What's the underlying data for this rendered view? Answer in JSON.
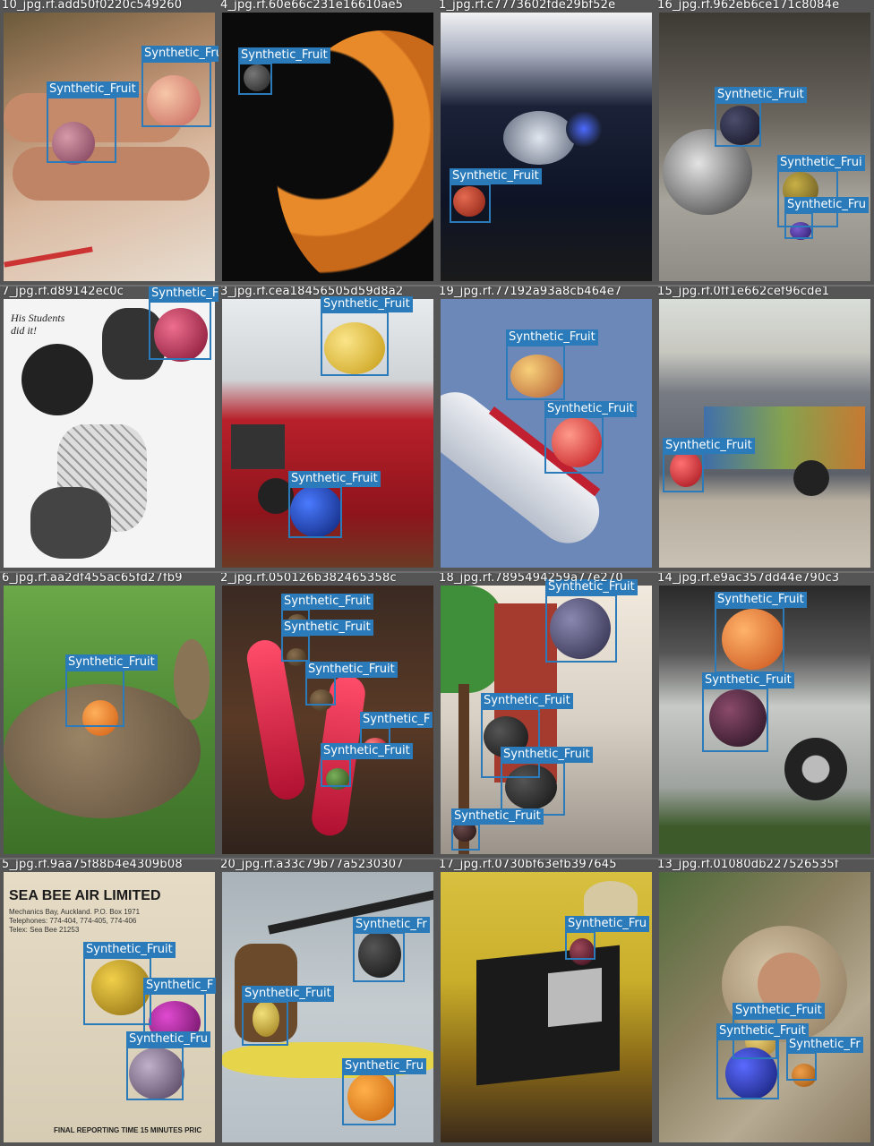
{
  "grid": {
    "columns": 4,
    "rows": 4,
    "box_color": "#2b7bba",
    "label_text_color": "#ffffff"
  },
  "tiles": [
    {
      "filename": "10_jpg.rf.add50f0220c549260",
      "labels": [
        "Synthetic_Fruit",
        "Synthetic_Fruit"
      ]
    },
    {
      "filename": "4_jpg.rf.60e66c231e16610ae5",
      "labels": [
        "Synthetic_Fruit"
      ]
    },
    {
      "filename": "1_jpg.rf.c7773602fde29bf52e",
      "labels": [
        "Synthetic_Fruit"
      ]
    },
    {
      "filename": "16_jpg.rf.962eb6ce171c8084e",
      "labels": [
        "Synthetic_Fruit",
        "Synthetic_Frui",
        "Synthetic_Fru"
      ]
    },
    {
      "filename": "7_jpg.rf.d89142ec0c",
      "labels": [
        "Synthetic_Fruit"
      ]
    },
    {
      "filename": "3_jpg.rf.cea18456505d59d8a2",
      "labels": [
        "Synthetic_Fruit",
        "Synthetic_Fruit"
      ]
    },
    {
      "filename": "19_jpg.rf.77192a93a8cb464e7",
      "labels": [
        "Synthetic_Fruit",
        "Synthetic_Fruit"
      ]
    },
    {
      "filename": "15_jpg.rf.0ff1e662cef96cde1",
      "labels": [
        "Synthetic_Fruit"
      ]
    },
    {
      "filename": "6_jpg.rf.aa2df455ac65fd27fb9",
      "labels": [
        "Synthetic_Fruit"
      ]
    },
    {
      "filename": "2_jpg.rf.050126b382465358c",
      "labels": [
        "Synthetic_Fruit",
        "Synthetic_Fruit",
        "Synthetic_Fruit",
        "Synthetic_F",
        "Synthetic_Fruit"
      ]
    },
    {
      "filename": "18_jpg.rf.7895494259a77e270",
      "labels": [
        "Synthetic_Fruit",
        "Synthetic_Fruit",
        "Synthetic_Fruit",
        "Synthetic_Fruit"
      ]
    },
    {
      "filename": "14_jpg.rf.e9ac357dd44e790c3",
      "labels": [
        "Synthetic_Fruit",
        "Synthetic_Fruit"
      ]
    },
    {
      "filename": "5_jpg.rf.9aa75f88b4e4309b08",
      "labels": [
        "Synthetic_Fruit",
        "Synthetic_F",
        "Synthetic_Fru"
      ]
    },
    {
      "filename": "20_jpg.rf.a33c79b77a5230307",
      "labels": [
        "Synthetic_Fr",
        "Synthetic_Fruit",
        "Synthetic_Fru"
      ]
    },
    {
      "filename": "17_jpg.rf.0730bf63efb397645",
      "labels": [
        "Synthetic_Fru"
      ]
    },
    {
      "filename": "13_jpg.rf.01080db227526535f",
      "labels": [
        "Synthetic_Fruit",
        "Synthetic_Fruit",
        "Synthetic_Fr"
      ]
    }
  ],
  "scene_text": {
    "comic_caption": "His Students did it!",
    "ticket_company": "SEA BEE AIR LIMITED",
    "ticket_address": "Mechanics Bay, Auckland. P.O. Box 1971",
    "ticket_phones": "Telephones: 774-404, 774-405, 774-406",
    "ticket_telex": "Telex: Sea Bee 21253",
    "ticket_footer": "FINAL REPORTING TIME 15 MINUTES PRIC"
  }
}
